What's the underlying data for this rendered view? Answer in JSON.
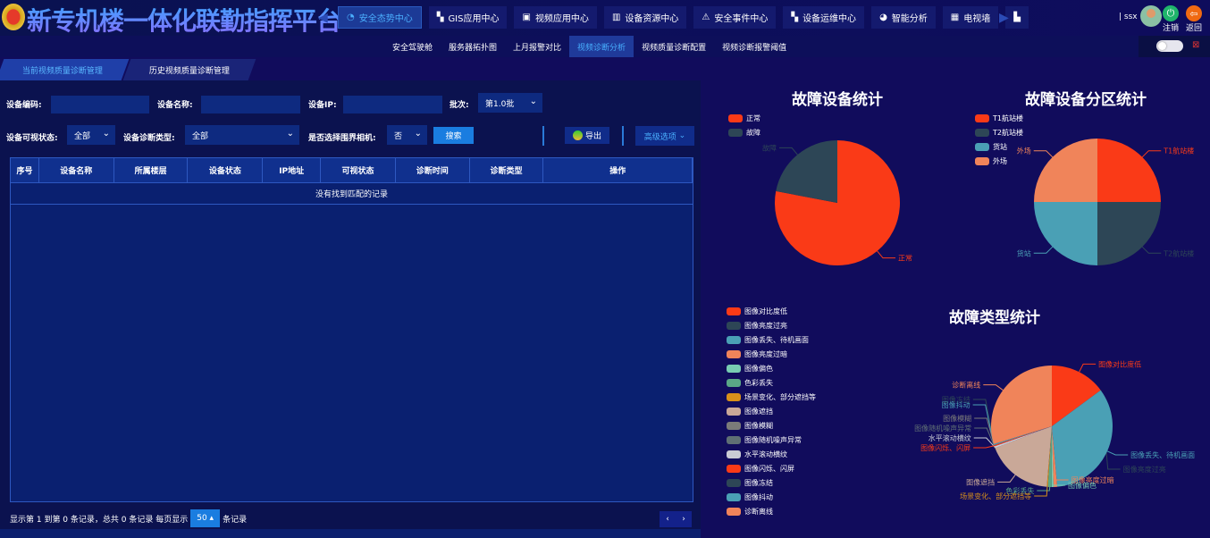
{
  "header": {
    "title": "新专机楼一体化联勤指挥平台",
    "nav": [
      {
        "label": "安全态势中心",
        "icon": "dashboard-icon",
        "active": true
      },
      {
        "label": "GIS应用中心",
        "icon": "map-icon"
      },
      {
        "label": "视频应用中心",
        "icon": "monitor-icon"
      },
      {
        "label": "设备资源中心",
        "icon": "device-icon"
      },
      {
        "label": "安全事件中心",
        "icon": "alarm-icon"
      },
      {
        "label": "设备运维中心",
        "icon": "wrench-icon"
      },
      {
        "label": "智能分析",
        "icon": "pie-icon"
      },
      {
        "label": "电视墙",
        "icon": "grid-icon"
      },
      {
        "label": "",
        "icon": "bar-chart-icon"
      }
    ],
    "user": "| ssx",
    "logout": "注销",
    "back": "返回"
  },
  "subnav": [
    {
      "label": "安全驾驶舱"
    },
    {
      "label": "服务器拓扑图"
    },
    {
      "label": "上月报警对比"
    },
    {
      "label": "视频诊断分析",
      "active": true
    },
    {
      "label": "视频质量诊断配置"
    },
    {
      "label": "视频诊断报警阈值"
    }
  ],
  "tabs": [
    {
      "label": "当前视频质量诊断管理",
      "active": true
    },
    {
      "label": "历史视频质量诊断管理"
    }
  ],
  "filters": {
    "code_label": "设备编码:",
    "code_value": "",
    "name_label": "设备名称:",
    "name_value": "",
    "ip_label": "设备IP:",
    "ip_value": "",
    "batch_label": "批次:",
    "batch_value": "第1.0批",
    "visible_label": "设备可视状态:",
    "visible_value": "全部",
    "diag_label": "设备诊断类型:",
    "diag_value": "全部",
    "perimeter_label": "是否选择围界相机:",
    "perimeter_value": "否",
    "search": "搜索",
    "export": "导出",
    "advanced": "高级选项"
  },
  "table": {
    "columns": [
      "序号",
      "设备名称",
      "所属楼层",
      "设备状态",
      "IP地址",
      "可视状态",
      "诊断时间",
      "诊断类型",
      "操作"
    ],
    "empty": "没有找到匹配的记录"
  },
  "pagination": {
    "info": "显示第 1 到第 0 条记录，总共 0 条记录 每页显示",
    "page_size": "50",
    "suffix": "条记录",
    "prev": "‹",
    "next": "›"
  },
  "chart_data": [
    {
      "type": "pie",
      "title": "故障设备统计",
      "categories": [
        "正常",
        "故障"
      ],
      "values": [
        78,
        22
      ],
      "colors": [
        "#fa3a17",
        "#2d4656"
      ],
      "legend": "top-left"
    },
    {
      "type": "pie",
      "title": "故障设备分区统计",
      "categories": [
        "T1航站楼",
        "T2航站楼",
        "货站",
        "外场"
      ],
      "values": [
        25,
        25,
        25,
        25
      ],
      "colors": [
        "#fa3a17",
        "#2d4656",
        "#4aa0b5",
        "#f0845a"
      ],
      "legend": "top-left"
    },
    {
      "type": "pie",
      "title": "故障类型统计",
      "categories": [
        "图像对比度低",
        "图像亮度过亮",
        "图像丢失、待机画面",
        "图像亮度过暗",
        "图像偏色",
        "色彩丢失",
        "场景变化、部分遮挡等",
        "图像遮挡",
        "图像模糊",
        "图像随机噪声异常",
        "水平滚动横纹",
        "图像闪烁、闪屏",
        "图像冻结",
        "图像抖动",
        "诊断离线"
      ],
      "values": [
        15,
        0,
        34,
        1,
        0.5,
        1,
        0.3,
        18,
        0,
        0,
        0.5,
        0.3,
        0,
        0.3,
        30
      ],
      "colors": [
        "#fa3a17",
        "#2d4656",
        "#4aa0b5",
        "#f0845a",
        "#78ccb2",
        "#5aa886",
        "#d8901a",
        "#c9a898",
        "#7b7b79",
        "#5f6f74",
        "#c9ccd4",
        "#fa3a17",
        "#2d4656",
        "#4aa0b5",
        "#f0845a"
      ],
      "legend": "left"
    }
  ]
}
